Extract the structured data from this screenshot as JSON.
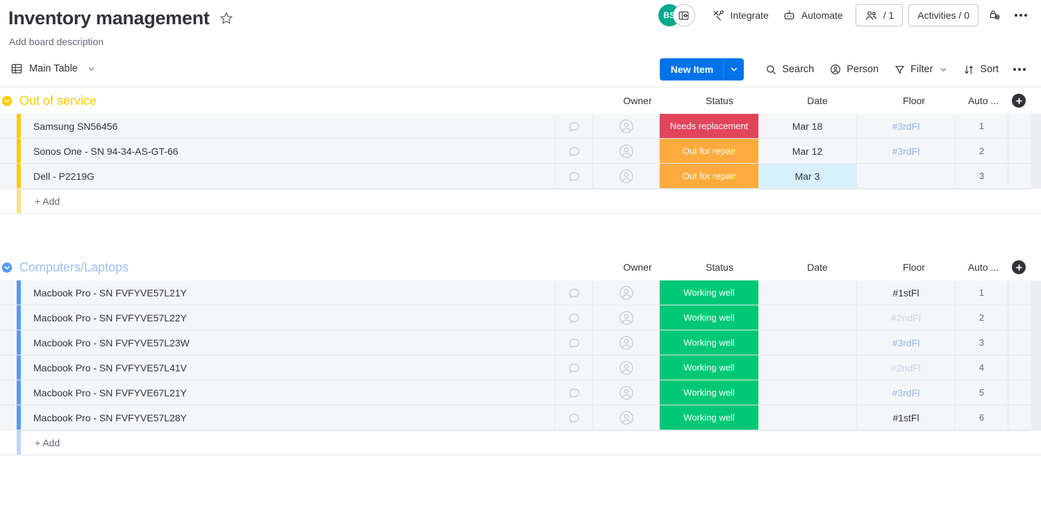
{
  "header": {
    "title": "Inventory management",
    "star_icon": "star-icon",
    "description_placeholder": "Add board description",
    "avatars": [
      {
        "initials": "BS",
        "color": "#00a88c",
        "name": "user-avatar-bs"
      },
      {
        "initials": "",
        "color": "#ffffff",
        "name": "board-avatar"
      }
    ],
    "buttons": [
      {
        "label": "Integrate",
        "icon": "integrate-icon"
      },
      {
        "label": "Automate",
        "icon": "automate-robot-icon"
      }
    ],
    "invite": {
      "label": "/ 1",
      "icon": "people-icon"
    },
    "activities": {
      "label": "Activities / 0"
    },
    "permissions_icon": "board-permissions-lock-icon",
    "more_icon": "more-options-icon"
  },
  "toolbar": {
    "view_tab": {
      "label": "Main Table",
      "icon": "table-icon",
      "caret": "chevron-down-icon"
    },
    "new_item": {
      "label": "New Item",
      "caret": "chevron-down-icon"
    },
    "actions": [
      {
        "label": "Search",
        "icon": "search-icon",
        "caret": false
      },
      {
        "label": "Person",
        "icon": "person-icon",
        "caret": false
      },
      {
        "label": "Filter",
        "icon": "filter-funnel-icon",
        "caret": true
      },
      {
        "label": "Sort",
        "icon": "sort-arrows-icon",
        "caret": false
      }
    ],
    "more_icon": "more-options-icon"
  },
  "columns": {
    "headers": [
      "Owner",
      "Status",
      "Date",
      "Floor",
      "Auto ..."
    ],
    "add_column_label": "+"
  },
  "colors": {
    "accent_blue": "#0073ea",
    "group_yellow": "#ffcb00",
    "group_blue": "#579bfc",
    "status_red": "#e2445c",
    "status_orange": "#fdab3d",
    "status_green": "#00c875",
    "date_highlight": "#d6f0fc",
    "floor_blue": "#8eb5e8",
    "floor_gray": "#d0d4e4",
    "floor_dark": "#323338"
  },
  "groups": [
    {
      "name": "Out of service",
      "color": "#ffcb00",
      "title_color": "#ffcb00",
      "collapse_icon": "chevron-down-circle-icon",
      "add_label": "+ Add",
      "items": [
        {
          "name": "Samsung SN56456",
          "chat_icon": "comment-bubble-icon",
          "owner_icon": "person-placeholder-icon",
          "status": "Needs replacement",
          "status_color": "#e2445c",
          "date": "Mar 18",
          "date_highlight": false,
          "floor": "#3rdFl",
          "floor_color": "#8eb5e8",
          "auto": "1"
        },
        {
          "name": "Sonos One - SN 94-34-AS-GT-66",
          "chat_icon": "comment-bubble-icon",
          "owner_icon": "person-placeholder-icon",
          "status": "Out for repair",
          "status_color": "#fdab3d",
          "date": "Mar 12",
          "date_highlight": false,
          "floor": "#3rdFl",
          "floor_color": "#8eb5e8",
          "auto": "2"
        },
        {
          "name": "Dell - P2219G",
          "chat_icon": "comment-bubble-icon",
          "owner_icon": "person-placeholder-icon",
          "status": "Out for repair",
          "status_color": "#fdab3d",
          "date": "Mar 3",
          "date_highlight": true,
          "floor": "",
          "floor_color": "#323338",
          "auto": "3"
        }
      ]
    },
    {
      "name": "Computers/Laptops",
      "color": "#579bfc",
      "title_color": "#9cc0f7",
      "collapse_icon": "chevron-down-circle-icon",
      "add_label": "+ Add",
      "items": [
        {
          "name": "Macbook Pro - SN FVFYVE57L21Y",
          "chat_icon": "comment-bubble-icon",
          "owner_icon": "person-placeholder-icon",
          "status": "Working well",
          "status_color": "#00c875",
          "date": "",
          "date_highlight": false,
          "floor": "#1stFl",
          "floor_color": "#323338",
          "auto": "1"
        },
        {
          "name": "Macbook Pro - SN FVFYVE57L22Y",
          "chat_icon": "comment-bubble-icon",
          "owner_icon": "person-placeholder-icon",
          "status": "Working well",
          "status_color": "#00c875",
          "date": "",
          "date_highlight": false,
          "floor": "#2ndFl",
          "floor_color": "#d0d4e4",
          "auto": "2"
        },
        {
          "name": "Macbook Pro - SN FVFYVE57L23W",
          "chat_icon": "comment-bubble-icon",
          "owner_icon": "person-placeholder-icon",
          "status": "Working well",
          "status_color": "#00c875",
          "date": "",
          "date_highlight": false,
          "floor": "#3rdFl",
          "floor_color": "#8eb5e8",
          "auto": "3"
        },
        {
          "name": "Macbook Pro - SN FVFYVE57L41V",
          "chat_icon": "comment-bubble-icon",
          "owner_icon": "person-placeholder-icon",
          "status": "Working well",
          "status_color": "#00c875",
          "date": "",
          "date_highlight": false,
          "floor": "#2ndFl",
          "floor_color": "#d0d4e4",
          "auto": "4"
        },
        {
          "name": "Macbook Pro - SN FVFYVE67L21Y",
          "chat_icon": "comment-bubble-icon",
          "owner_icon": "person-placeholder-icon",
          "status": "Working well",
          "status_color": "#00c875",
          "date": "",
          "date_highlight": false,
          "floor": "#3rdFl",
          "floor_color": "#8eb5e8",
          "auto": "5"
        },
        {
          "name": "Macbook Pro - SN FVFYVE57L28Y",
          "chat_icon": "comment-bubble-icon",
          "owner_icon": "person-placeholder-icon",
          "status": "Working well",
          "status_color": "#00c875",
          "date": "",
          "date_highlight": false,
          "floor": "#1stFl",
          "floor_color": "#323338",
          "auto": "6"
        }
      ]
    }
  ]
}
